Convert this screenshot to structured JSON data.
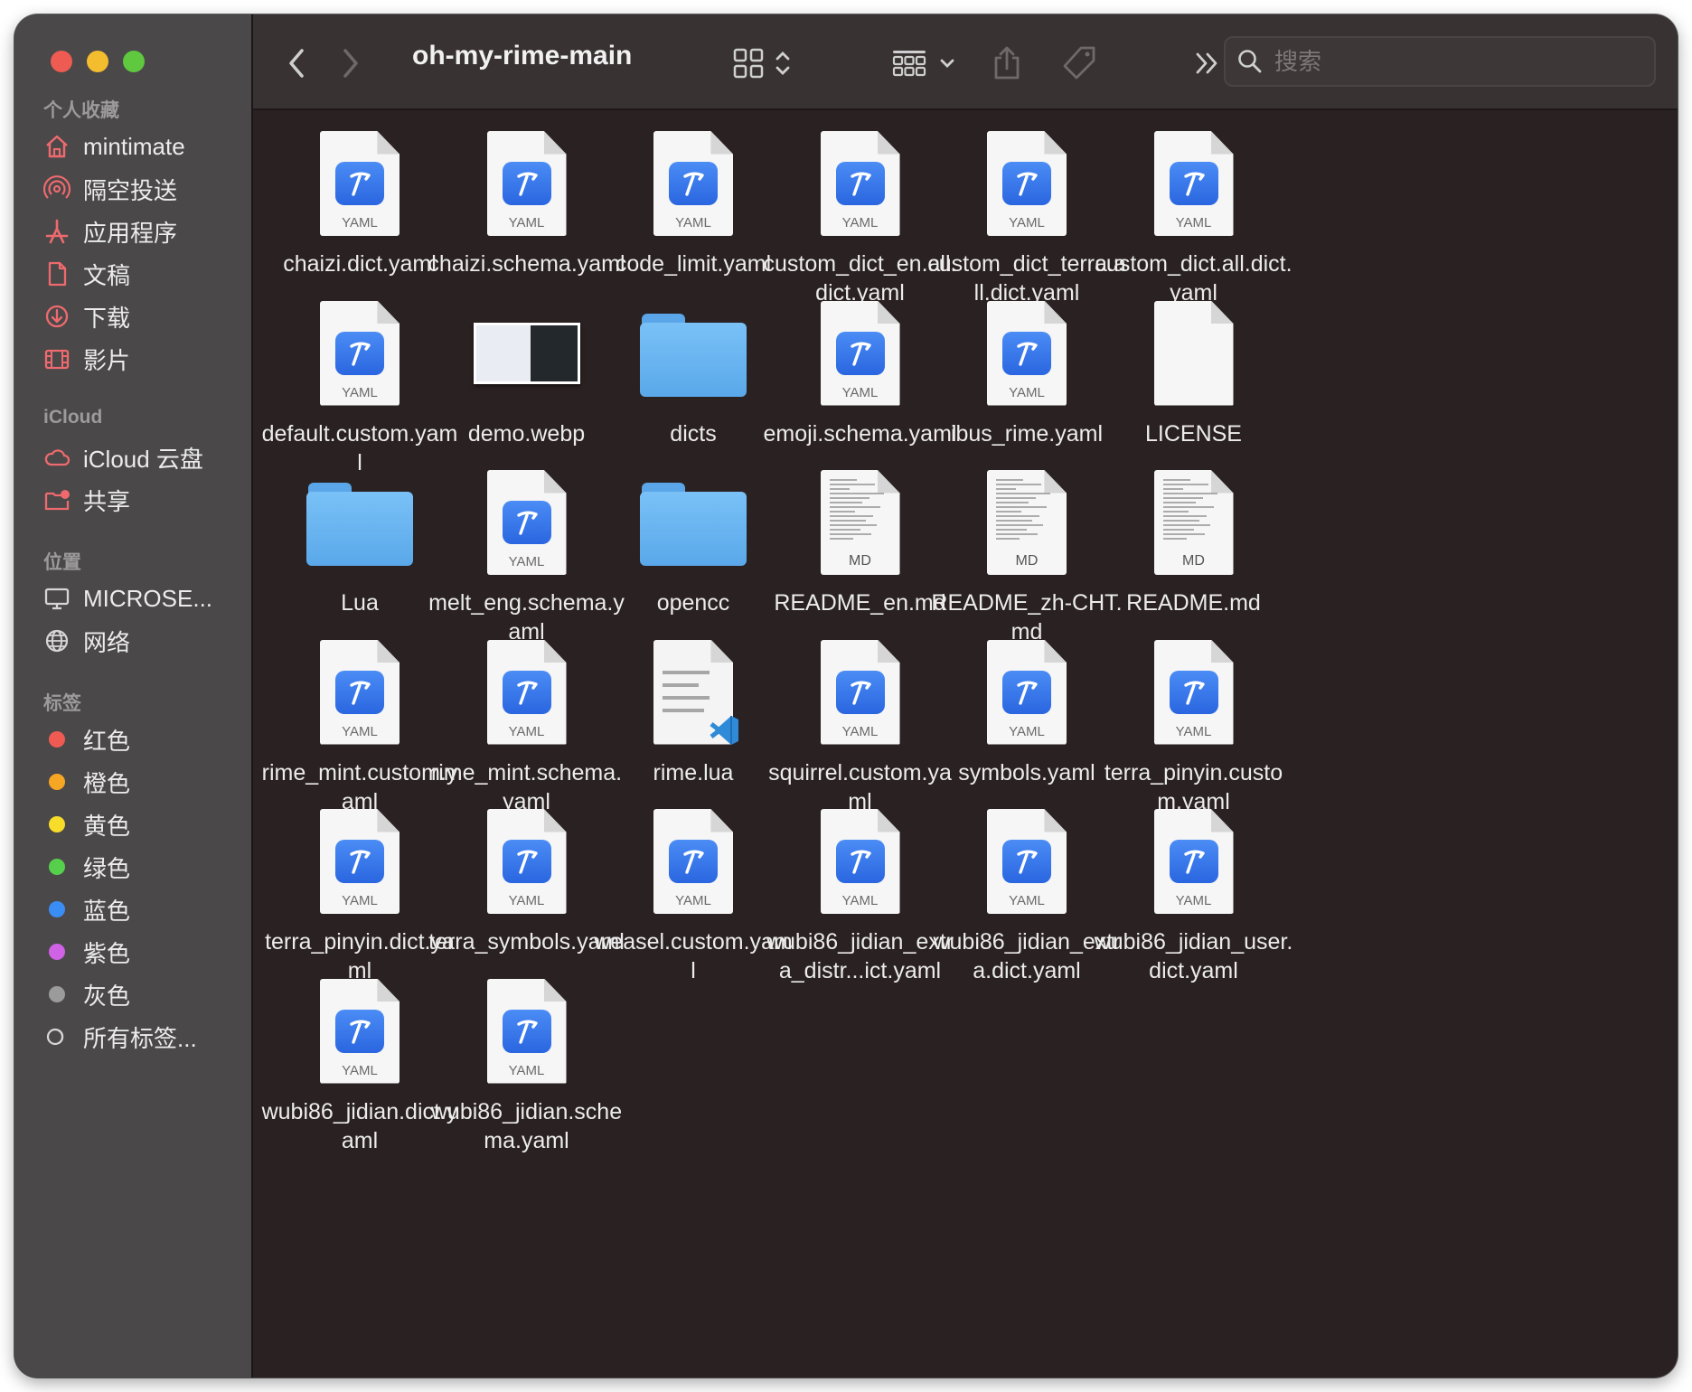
{
  "window": {
    "title": "oh-my-rime-main",
    "traffic_colors": [
      "#ee5b52",
      "#f3bd2f",
      "#5fc83f"
    ]
  },
  "toolbar": {
    "back_icon": "chevron-left-icon",
    "forward_icon": "chevron-right-icon",
    "view_icon": "grid-view-icon",
    "group_icon": "group-by-icon",
    "share_icon": "share-icon",
    "tag_icon": "tag-icon",
    "more_icon": "double-chevron-right-icon",
    "search_placeholder": "搜索"
  },
  "sidebar": {
    "sections": [
      {
        "title": "个人收藏",
        "items": [
          {
            "label": "mintimate",
            "icon": "home-icon"
          },
          {
            "label": "隔空投送",
            "icon": "airdrop-icon"
          },
          {
            "label": "应用程序",
            "icon": "applications-icon"
          },
          {
            "label": "文稿",
            "icon": "document-icon"
          },
          {
            "label": "下载",
            "icon": "download-icon"
          },
          {
            "label": "影片",
            "icon": "film-icon"
          }
        ]
      },
      {
        "title": "iCloud",
        "items": [
          {
            "label": "iCloud 云盘",
            "icon": "cloud-icon"
          },
          {
            "label": "共享",
            "icon": "shared-folder-icon"
          }
        ]
      },
      {
        "title": "位置",
        "items": [
          {
            "label": "MICROSE...",
            "icon": "display-icon"
          },
          {
            "label": "网络",
            "icon": "globe-icon"
          }
        ]
      },
      {
        "title": "标签",
        "items": [
          {
            "label": "红色",
            "color": "#ef5b52"
          },
          {
            "label": "橙色",
            "color": "#f6a623"
          },
          {
            "label": "黄色",
            "color": "#f7dc2a"
          },
          {
            "label": "绿色",
            "color": "#56cf4c"
          },
          {
            "label": "蓝色",
            "color": "#3b8df6"
          },
          {
            "label": "紫色",
            "color": "#cf62e5"
          },
          {
            "label": "灰色",
            "color": "#9b9b9b"
          },
          {
            "label": "所有标签...",
            "icon": "all-tags-icon"
          }
        ]
      }
    ]
  },
  "files": [
    {
      "name": "chaizi.dict.yaml",
      "type": "yaml"
    },
    {
      "name": "chaizi.schema.yaml",
      "type": "yaml"
    },
    {
      "name": "code_limit.yaml",
      "type": "yaml"
    },
    {
      "name": "custom_dict_en.all.dict.yaml",
      "type": "yaml"
    },
    {
      "name": "custom_dict_terra.all.dict.yaml",
      "type": "yaml"
    },
    {
      "name": "custom_dict.all.dict.yaml",
      "type": "yaml"
    },
    {
      "name": "default.custom.yaml",
      "type": "yaml"
    },
    {
      "name": "demo.webp",
      "type": "image"
    },
    {
      "name": "dicts",
      "type": "folder"
    },
    {
      "name": "emoji.schema.yaml",
      "type": "yaml"
    },
    {
      "name": "ibus_rime.yaml",
      "type": "yaml"
    },
    {
      "name": "LICENSE",
      "type": "blank"
    },
    {
      "name": "Lua",
      "type": "folder"
    },
    {
      "name": "melt_eng.schema.yaml",
      "type": "yaml"
    },
    {
      "name": "opencc",
      "type": "folder"
    },
    {
      "name": "README_en.md",
      "type": "md"
    },
    {
      "name": "README_zh-CHT.md",
      "type": "md"
    },
    {
      "name": "README.md",
      "type": "md"
    },
    {
      "name": "rime_mint.custom.yaml",
      "type": "yaml"
    },
    {
      "name": "rime_mint.schema.yaml",
      "type": "yaml"
    },
    {
      "name": "rime.lua",
      "type": "lua"
    },
    {
      "name": "squirrel.custom.yaml",
      "type": "yaml"
    },
    {
      "name": "symbols.yaml",
      "type": "yaml"
    },
    {
      "name": "terra_pinyin.custom.yaml",
      "type": "yaml"
    },
    {
      "name": "terra_pinyin.dict.yaml",
      "type": "yaml"
    },
    {
      "name": "terra_symbols.yaml",
      "type": "yaml"
    },
    {
      "name": "weasel.custom.yaml",
      "type": "yaml"
    },
    {
      "name": "wubi86_jidian_extra_distr...ict.yaml",
      "type": "yaml"
    },
    {
      "name": "wubi86_jidian_extra.dict.yaml",
      "type": "yaml"
    },
    {
      "name": "wubi86_jidian_user.dict.yaml",
      "type": "yaml"
    },
    {
      "name": "wubi86_jidian.dict.yaml",
      "type": "yaml"
    },
    {
      "name": "wubi86_jidian.schema.yaml",
      "type": "yaml"
    }
  ],
  "labels": {
    "yaml": "YAML",
    "md": "MD"
  }
}
